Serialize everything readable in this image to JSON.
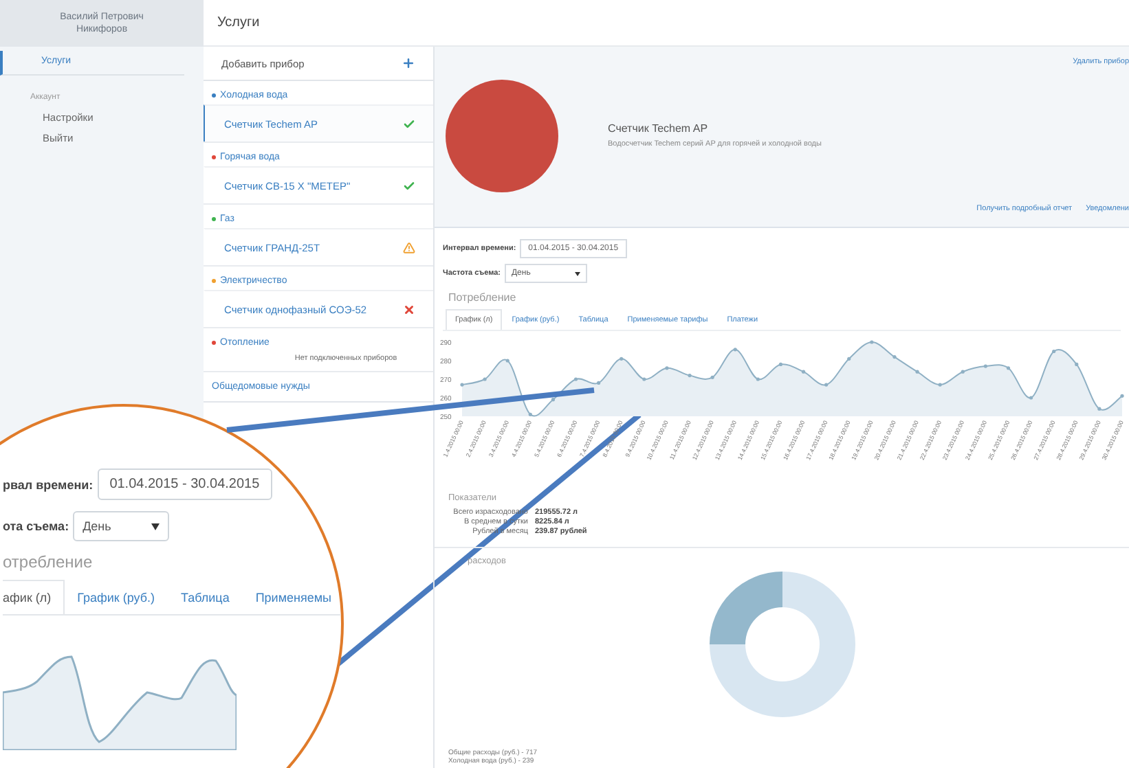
{
  "sidebar": {
    "user": "Василий Петрович Никифоров",
    "items": [
      {
        "label": "Услуги",
        "selected": true
      }
    ],
    "section": "Аккаунт",
    "account_items": [
      {
        "label": "Настройки"
      },
      {
        "label": "Выйти"
      }
    ]
  },
  "header": {
    "title": "Услуги"
  },
  "devices": {
    "add_label": "Добавить прибор",
    "groups": [
      {
        "name": "Холодная вода",
        "color": "#3a7fc1",
        "items": [
          {
            "name": "Счетчик Techem AP",
            "kind": "ok",
            "selected": true
          }
        ]
      },
      {
        "name": "Горячая вода",
        "color": "#e0473a",
        "items": [
          {
            "name": "Счетчик СВ-15 Х \"МЕТЕР\"",
            "kind": "ok",
            "selected": false
          }
        ]
      },
      {
        "name": "Газ",
        "color": "#3fb34f",
        "items": [
          {
            "name": "Счетчик ГРАНД-25Т",
            "kind": "warning",
            "selected": false
          }
        ]
      },
      {
        "name": "Электричество",
        "color": "#f0a030",
        "items": [
          {
            "name": "Счетчик однофазный СОЭ-52",
            "kind": "error",
            "selected": false
          }
        ]
      },
      {
        "name": "Отопление",
        "color": "#e0473a",
        "empty": "Нет подключенных приборов"
      }
    ],
    "footer": "Общедомовые нужды"
  },
  "device": {
    "delete": "Удалить прибор",
    "name": "Счетчик Techem AP",
    "description": "Водосчетчик Techem серий AP для горячей и холодной воды",
    "actions": [
      "Получить подробный отчет",
      "Уведомлени"
    ]
  },
  "filters": {
    "interval_label": "Интервал времени:",
    "interval": "01.04.2015 - 30.04.2015",
    "frequency_label": "Частота съема:",
    "frequency": "День"
  },
  "consumption": {
    "title": "Потребление",
    "tabs": [
      {
        "label": "График (л)",
        "selected": true
      },
      {
        "label": "График (руб.)",
        "selected": false
      },
      {
        "label": "Таблица",
        "selected": false
      },
      {
        "label": "Применяемые тарифы",
        "selected": false
      },
      {
        "label": "Платежи",
        "selected": false
      }
    ],
    "chart_data": {
      "type": "area",
      "categories": [
        "1.4.2015 00:00",
        "2.4.2015 00:00",
        "3.4.2015 00:00",
        "4.4.2015 00:00",
        "5.4.2015 00:00",
        "6.4.2015 00:00",
        "7.4.2015 00:00",
        "8.4.2015 00:00",
        "9.4.2015 00:00",
        "10.4.2015 00:00",
        "11.4.2015 00:00",
        "12.4.2015 00:00",
        "13.4.2015 00:00",
        "14.4.2015 00:00",
        "15.4.2015 00:00",
        "16.4.2015 00:00",
        "17.4.2015 00:00",
        "18.4.2015 00:00",
        "19.4.2015 00:00",
        "20.4.2015 00:00",
        "21.4.2015 00:00",
        "22.4.2015 00:00",
        "23.4.2015 00:00",
        "24.4.2015 00:00",
        "25.4.2015 00:00",
        "26.4.2015 00:00",
        "27.4.2015 00:00",
        "28.4.2015 00:00",
        "29.4.2015 00:00",
        "30.4.2015 00:00"
      ],
      "series": [
        {
          "color": "#8fb0c4",
          "values": [
            267,
            270,
            280,
            251,
            259,
            270,
            268,
            281,
            270,
            276,
            272,
            271,
            286,
            270,
            278,
            274,
            267,
            281,
            290,
            282,
            274,
            267,
            274,
            277,
            276,
            260,
            285,
            278,
            254,
            261
          ]
        }
      ],
      "ylim": [
        250,
        290
      ],
      "yticks": [
        250,
        260,
        270,
        280,
        290
      ]
    }
  },
  "indicators": {
    "title": "Показатели",
    "rows": [
      {
        "label": "Всего израсходовано",
        "value": "219555.72 л"
      },
      {
        "label": "В среднем в сутки",
        "value": "8225.84 л"
      },
      {
        "label": "Рублей в месяц",
        "value": "239.87 рублей"
      }
    ]
  },
  "expenses": {
    "title": "расходов",
    "chart_data": {
      "type": "donut",
      "values": [
        75,
        25
      ]
    },
    "legend": [
      "Общие расходы (руб.) - 717",
      "Холодная вода (руб.) - 239"
    ]
  },
  "magnifier": {
    "interval_label": "рвал времени:",
    "interval": "01.04.2015 - 30.04.2015",
    "frequency_label": "ота съема:",
    "frequency": "День",
    "title": "отребление",
    "tabs": [
      {
        "label": "афик (л)",
        "selected": true
      },
      {
        "label": "График (руб.)",
        "selected": false
      },
      {
        "label": "Таблица",
        "selected": false
      },
      {
        "label": "Применяемы",
        "selected": false
      }
    ]
  }
}
